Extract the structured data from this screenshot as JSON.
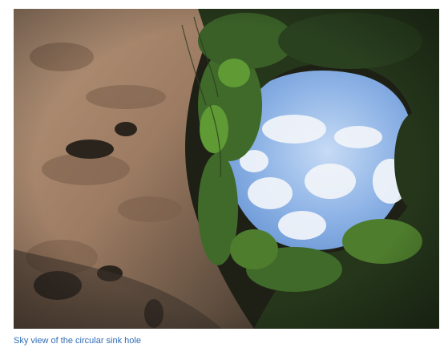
{
  "photo": {
    "subject": "sky-through-sinkhole",
    "colors": {
      "rock_light": "#a4846c",
      "rock_dark": "#5a4a3c",
      "foliage": "#3f6a2a",
      "foliage_bright": "#5f9a34",
      "sky": "#8fb4e6",
      "cloud": "#f2f5fa",
      "shadow": "#1e2016"
    }
  },
  "caption": {
    "text": "Sky view of the circular sink hole",
    "color": "#2f6db5"
  }
}
